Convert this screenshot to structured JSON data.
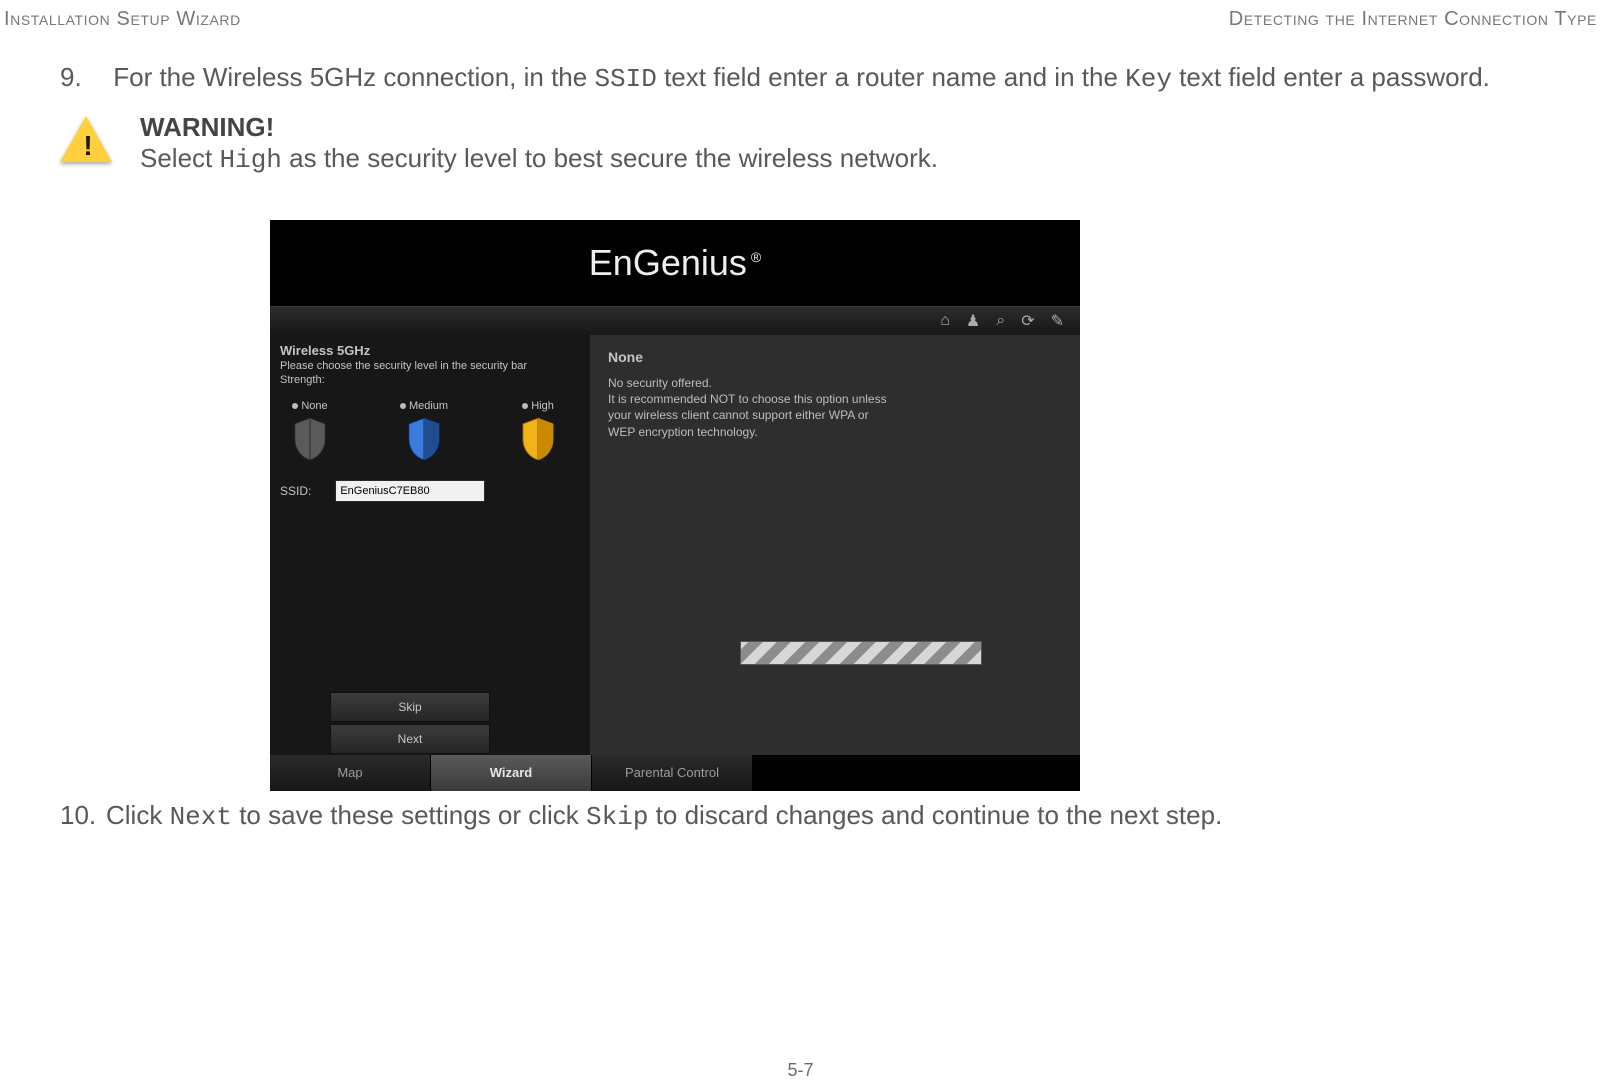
{
  "header": {
    "left": "Installation Setup Wizard",
    "right": "Detecting the Internet Connection Type"
  },
  "step9": {
    "num": "9.",
    "a": "For the Wireless 5GHz connection, in the ",
    "code1": "SSID",
    "b": " text field enter a router name and in the ",
    "code2": "Key",
    "c": " text field enter a password."
  },
  "warning": {
    "title": "WARNING!",
    "a": "Select ",
    "code": "High",
    "b": " as the security level to best secure the wireless network."
  },
  "router": {
    "brand": "EnGenius",
    "left": {
      "title": "Wireless 5GHz",
      "sub": "Please choose the security level in the security bar",
      "strength_label": "Strength:",
      "levels": {
        "none": "None",
        "medium": "Medium",
        "high": "High"
      },
      "ssid_label": "SSID:",
      "ssid_value": "EnGeniusC7EB80"
    },
    "right": {
      "title": "None",
      "l1": "No security offered.",
      "l2": "It is recommended NOT to choose this option unless",
      "l3": "your wireless client cannot support either WPA or",
      "l4": "WEP encryption technology."
    },
    "buttons": {
      "skip": "Skip",
      "next": "Next"
    },
    "tabs": {
      "map": "Map",
      "wizard": "Wizard",
      "parental": "Parental Control"
    }
  },
  "step10": {
    "num": "10.",
    "a": "Click ",
    "code1": "Next",
    "b": " to save these settings or click ",
    "code2": "Skip",
    "c": " to discard changes and continue to the next step."
  },
  "page_no": "5-7"
}
